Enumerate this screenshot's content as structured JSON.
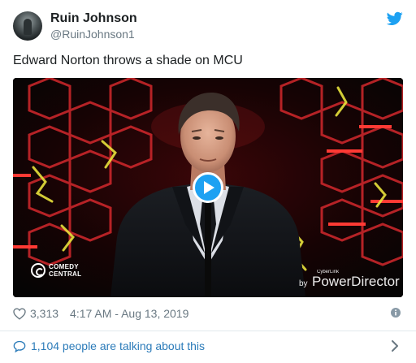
{
  "author": {
    "name": "Ruin Johnson",
    "handle": "@RuinJohnson1"
  },
  "tweet": {
    "text": "Edward Norton throws a shade on MCU"
  },
  "media": {
    "type": "video",
    "play_icon": "play-icon",
    "logos": {
      "comedy_central": [
        "COMEDY",
        "CENTRAL"
      ],
      "watermark_small": "CyberLink",
      "watermark_by": "by",
      "watermark_brand": "PowerDirector"
    }
  },
  "meta": {
    "likes": "3,313",
    "timestamp": "4:17 AM - Aug 13, 2019"
  },
  "footer": {
    "talking": "1,104 people are talking about this"
  },
  "colors": {
    "brand": "#1da1f2",
    "link": "#2b7bb9",
    "muted": "#697882",
    "text": "#1c2022",
    "divider": "#e1e8ed"
  },
  "icons": [
    "twitter-bird-icon",
    "play-icon",
    "heart-icon",
    "info-icon",
    "speech-bubble-icon",
    "chevron-right-icon"
  ]
}
